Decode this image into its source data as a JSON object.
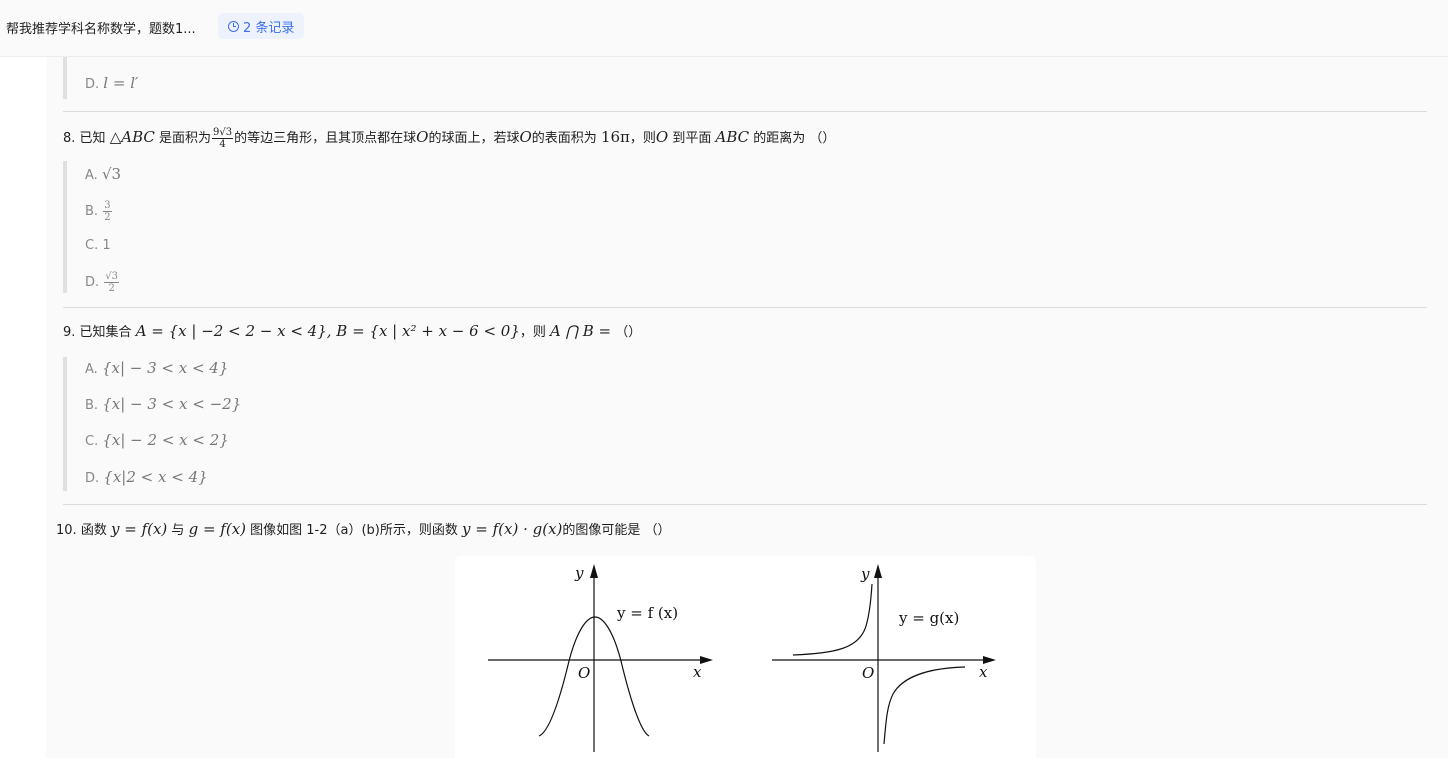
{
  "header": {
    "title": "帮我推荐学科名称数学，题数1...",
    "records_label": "2 条记录"
  },
  "q7_tail": {
    "option_d": {
      "label": "D.",
      "math": "l = l′"
    }
  },
  "q8": {
    "number": "8.",
    "text": {
      "p1": "已知",
      "tri": "△ABC",
      "p2": "是面积为",
      "frac_num": "9√3",
      "frac_den": "4",
      "p3": "的等边三角形，且其顶点都在球",
      "o1": "O",
      "p4": "的球面上，若球",
      "o2": "O",
      "p5": "的表面积为",
      "area": "16π",
      "p6": "，则",
      "o3": "O",
      "p7": "到平面",
      "plane": "ABC",
      "p8": "的距离为 （）"
    },
    "options": {
      "a_label": "A.",
      "a_math": "√3",
      "b_label": "B.",
      "b_num": "3",
      "b_den": "2",
      "c_label": "C. 1",
      "d_label": "D.",
      "d_num": "√3",
      "d_den": "2"
    }
  },
  "q9": {
    "number": "9.",
    "text": {
      "p1": "已知集合",
      "math": "A = {x | −2 < 2 − x < 4}, B = {x | x² + x − 6 < 0}",
      "p2": "，则",
      "math2": "A ⋂ B =",
      "p3": "（）"
    },
    "options": [
      {
        "label": "A.",
        "math": "{x| − 3 < x < 4}"
      },
      {
        "label": "B.",
        "math": "{x| − 3 < x < −2}"
      },
      {
        "label": "C.",
        "math": "{x| − 2 < x < 2}"
      },
      {
        "label": "D.",
        "math": "{x|2 < x < 4}"
      }
    ]
  },
  "q10": {
    "number": "10.",
    "text": {
      "p1": "函数",
      "m1": "y = f(x)",
      "p2": "与",
      "m2": "g = f(x)",
      "p3": "图像如图 1-2（a）(b)所示，则函数",
      "m3": "y = f(x) · g(x)",
      "p4": "的图像可能是 （）"
    },
    "figure": {
      "left": {
        "y_label": "y",
        "x_label": "x",
        "origin": "O",
        "func_label": "y = f (x)"
      },
      "right": {
        "y_label": "y",
        "x_label": "x",
        "origin": "O",
        "func_label": "y = g(x)"
      }
    }
  }
}
